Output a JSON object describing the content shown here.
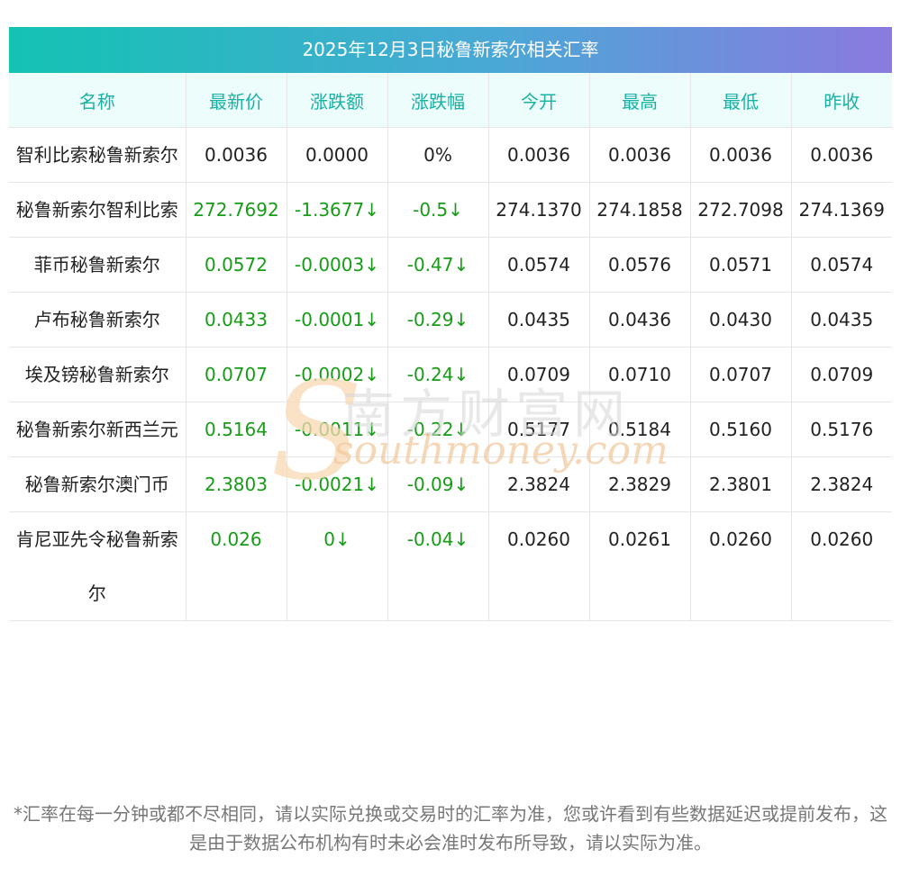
{
  "title": "2025年12月3日秘鲁新索尔相关汇率",
  "headers": [
    "名称",
    "最新价",
    "涨跌额",
    "涨跌幅",
    "今开",
    "最高",
    "最低",
    "昨收"
  ],
  "rows": [
    {
      "name": "智利比索秘鲁新索尔",
      "latest": "0.0036",
      "change": "0.0000",
      "pct": "0%",
      "open": "0.0036",
      "high": "0.0036",
      "low": "0.0036",
      "prev": "0.0036",
      "trend": "flat"
    },
    {
      "name": "秘鲁新索尔智利比索",
      "latest": "272.7692",
      "change": "-1.3677↓",
      "pct": "-0.5↓",
      "open": "274.1370",
      "high": "274.1858",
      "low": "272.7098",
      "prev": "274.1369",
      "trend": "down"
    },
    {
      "name": "菲币秘鲁新索尔",
      "latest": "0.0572",
      "change": "-0.0003↓",
      "pct": "-0.47↓",
      "open": "0.0574",
      "high": "0.0576",
      "low": "0.0571",
      "prev": "0.0574",
      "trend": "down"
    },
    {
      "name": "卢布秘鲁新索尔",
      "latest": "0.0433",
      "change": "-0.0001↓",
      "pct": "-0.29↓",
      "open": "0.0435",
      "high": "0.0436",
      "low": "0.0430",
      "prev": "0.0435",
      "trend": "down"
    },
    {
      "name": "埃及镑秘鲁新索尔",
      "latest": "0.0707",
      "change": "-0.0002↓",
      "pct": "-0.24↓",
      "open": "0.0709",
      "high": "0.0710",
      "low": "0.0707",
      "prev": "0.0709",
      "trend": "down"
    },
    {
      "name": "秘鲁新索尔新西兰元",
      "latest": "0.5164",
      "change": "-0.0011↓",
      "pct": "-0.22↓",
      "open": "0.5177",
      "high": "0.5184",
      "low": "0.5160",
      "prev": "0.5176",
      "trend": "down"
    },
    {
      "name": "秘鲁新索尔澳门币",
      "latest": "2.3803",
      "change": "-0.0021↓",
      "pct": "-0.09↓",
      "open": "2.3824",
      "high": "2.3829",
      "low": "2.3801",
      "prev": "2.3824",
      "trend": "down"
    },
    {
      "name": "肯尼亚先令秘鲁新索尔",
      "latest": "0.026",
      "change": "0↓",
      "pct": "-0.04↓",
      "open": "0.0260",
      "high": "0.0261",
      "low": "0.0260",
      "prev": "0.0260",
      "trend": "down"
    }
  ],
  "watermark": {
    "cn": "南方财富网",
    "en": "southmoney.com"
  },
  "footnote": "*汇率在每一分钟或都不尽相同，请以实际兑换或交易时的汇率为准，您或许看到有些数据延迟或提前发布，这是由于数据公布机构有时未必会准时发布所导致，请以实际为准。",
  "colors": {
    "header_text": "#18b1a4",
    "header_bg": "#ecfdfb",
    "down": "#169c16",
    "title_gradient": [
      "#13c3b3",
      "#8b7ae0"
    ]
  }
}
